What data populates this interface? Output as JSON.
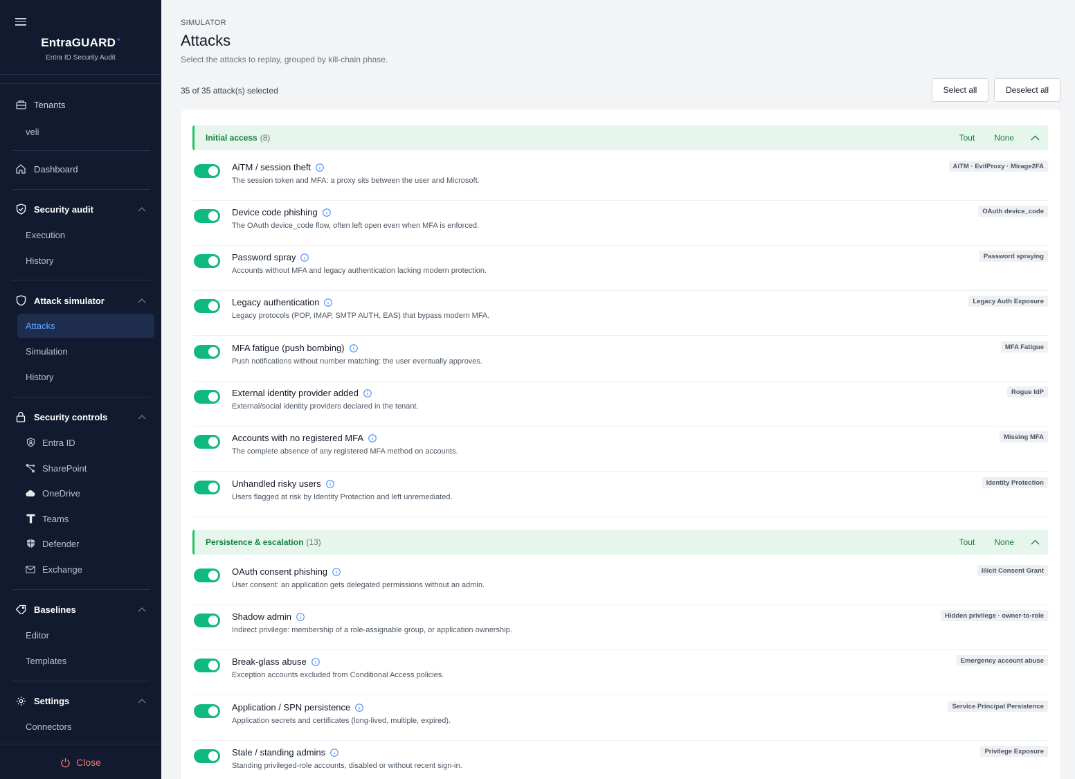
{
  "app": {
    "name": "EntraGUARD",
    "star": "*",
    "subtitle": "Entra ID Security Audit"
  },
  "sidebar": {
    "tenants_label": "Tenants",
    "tenant_name": "veli",
    "dashboard_label": "Dashboard",
    "security_audit": {
      "label": "Security audit",
      "items": [
        "Execution",
        "History"
      ]
    },
    "attack_simulator": {
      "label": "Attack simulator",
      "active_item": "Attacks",
      "items": [
        "Simulation",
        "History"
      ]
    },
    "security_controls": {
      "label": "Security controls",
      "items": [
        "Entra ID",
        "SharePoint",
        "OneDrive",
        "Teams",
        "Defender",
        "Exchange"
      ]
    },
    "baselines": {
      "label": "Baselines",
      "items": [
        "Editor",
        "Templates"
      ]
    },
    "settings": {
      "label": "Settings",
      "items": [
        "Connectors"
      ]
    },
    "close_label": "Close"
  },
  "page": {
    "eyebrow": "SIMULATOR",
    "title": "Attacks",
    "subtitle": "Select the attacks to replay, grouped by kill-chain phase.",
    "selection_count": "35 of 35 attack(s) selected",
    "select_all": "Select all",
    "deselect_all": "Deselect all"
  },
  "groups": [
    {
      "label": "Initial access",
      "count": "(8)",
      "all_label": "Tout",
      "none_label": "None"
    },
    {
      "label": "Persistence & escalation",
      "count": "(13)",
      "all_label": "Tout",
      "none_label": "None"
    }
  ],
  "attacks": [
    {
      "title": "AiTM / session theft",
      "desc": "The session token and MFA: a proxy sits between the user and Microsoft.",
      "tag": "AiTM · EvilProxy · Mirage2FA",
      "enabled": true
    },
    {
      "title": "Device code phishing",
      "desc": "The OAuth device_code flow, often left open even when MFA is enforced.",
      "tag": "OAuth device_code",
      "enabled": true
    },
    {
      "title": "Password spray",
      "desc": "Accounts without MFA and legacy authentication lacking modern protection.",
      "tag": "Password spraying",
      "enabled": true
    },
    {
      "title": "Legacy authentication",
      "desc": "Legacy protocols (POP, IMAP, SMTP AUTH, EAS) that bypass modern MFA.",
      "tag": "Legacy Auth Exposure",
      "enabled": true
    },
    {
      "title": "MFA fatigue (push bombing)",
      "desc": "Push notifications without number matching: the user eventually approves.",
      "tag": "MFA Fatigue",
      "enabled": true
    },
    {
      "title": "External identity provider added",
      "desc": "External/social identity providers declared in the tenant.",
      "tag": "Rogue IdP",
      "enabled": true
    },
    {
      "title": "Accounts with no registered MFA",
      "desc": "The complete absence of any registered MFA method on accounts.",
      "tag": "Missing MFA",
      "enabled": true
    },
    {
      "title": "Unhandled risky users",
      "desc": "Users flagged at risk by Identity Protection and left unremediated.",
      "tag": "Identity Protection",
      "enabled": true
    },
    {
      "title": "OAuth consent phishing",
      "desc": "User consent: an application gets delegated permissions without an admin.",
      "tag": "Illicit Consent Grant",
      "enabled": true
    },
    {
      "title": "Shadow admin",
      "desc": "Indirect privilege: membership of a role-assignable group, or application ownership.",
      "tag": "Hidden privilege · owner-to-role",
      "enabled": true
    },
    {
      "title": "Break-glass abuse",
      "desc": "Exception accounts excluded from Conditional Access policies.",
      "tag": "Emergency account abuse",
      "enabled": true
    },
    {
      "title": "Application / SPN persistence",
      "desc": "Application secrets and certificates (long-lived, multiple, expired).",
      "tag": "Service Principal Persistence",
      "enabled": true
    },
    {
      "title": "Stale / standing admins",
      "desc": "Standing privileged-role accounts, disabled or without recent sign-in.",
      "tag": "Privilege Exposure",
      "enabled": true
    }
  ]
}
